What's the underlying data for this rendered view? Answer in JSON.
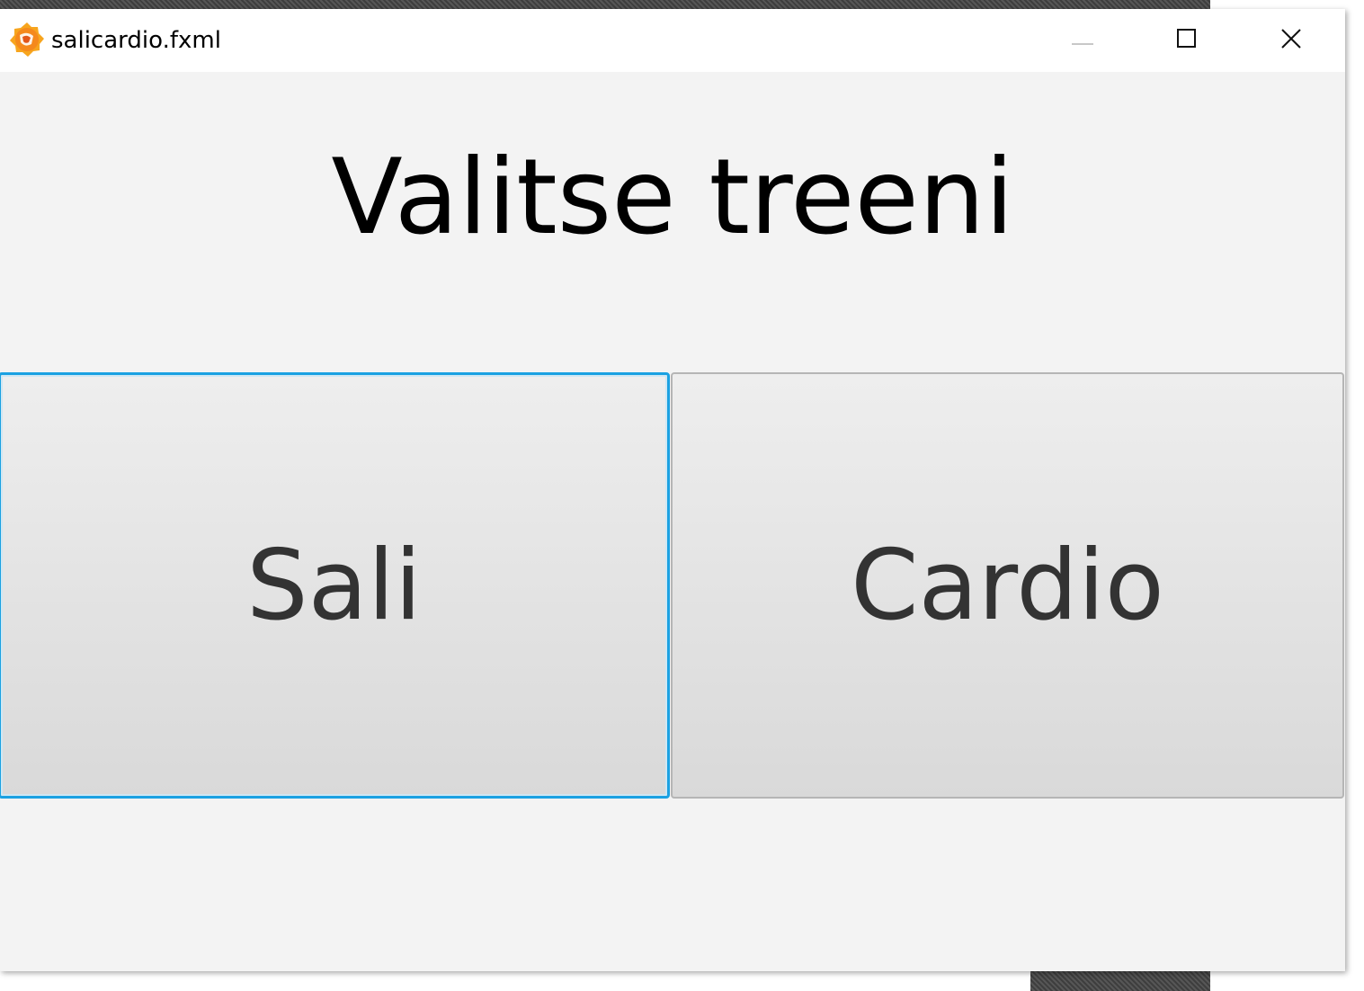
{
  "window": {
    "title": "salicardio.fxml",
    "controls": {
      "minimize": "minimize",
      "maximize": "maximize",
      "close": "close"
    }
  },
  "main": {
    "heading": "Valitse treeni",
    "buttons": [
      {
        "label": "Sali",
        "focused": true
      },
      {
        "label": "Cardio",
        "focused": false
      }
    ]
  },
  "colors": {
    "focus_border": "#1ba1e2",
    "background": "#f3f3f3",
    "button_text": "#333333",
    "icon_orange": "#f7a51e"
  },
  "icons": {
    "app": "java-app-icon",
    "minimize": "minimize-icon",
    "maximize": "maximize-icon",
    "close": "close-icon"
  }
}
